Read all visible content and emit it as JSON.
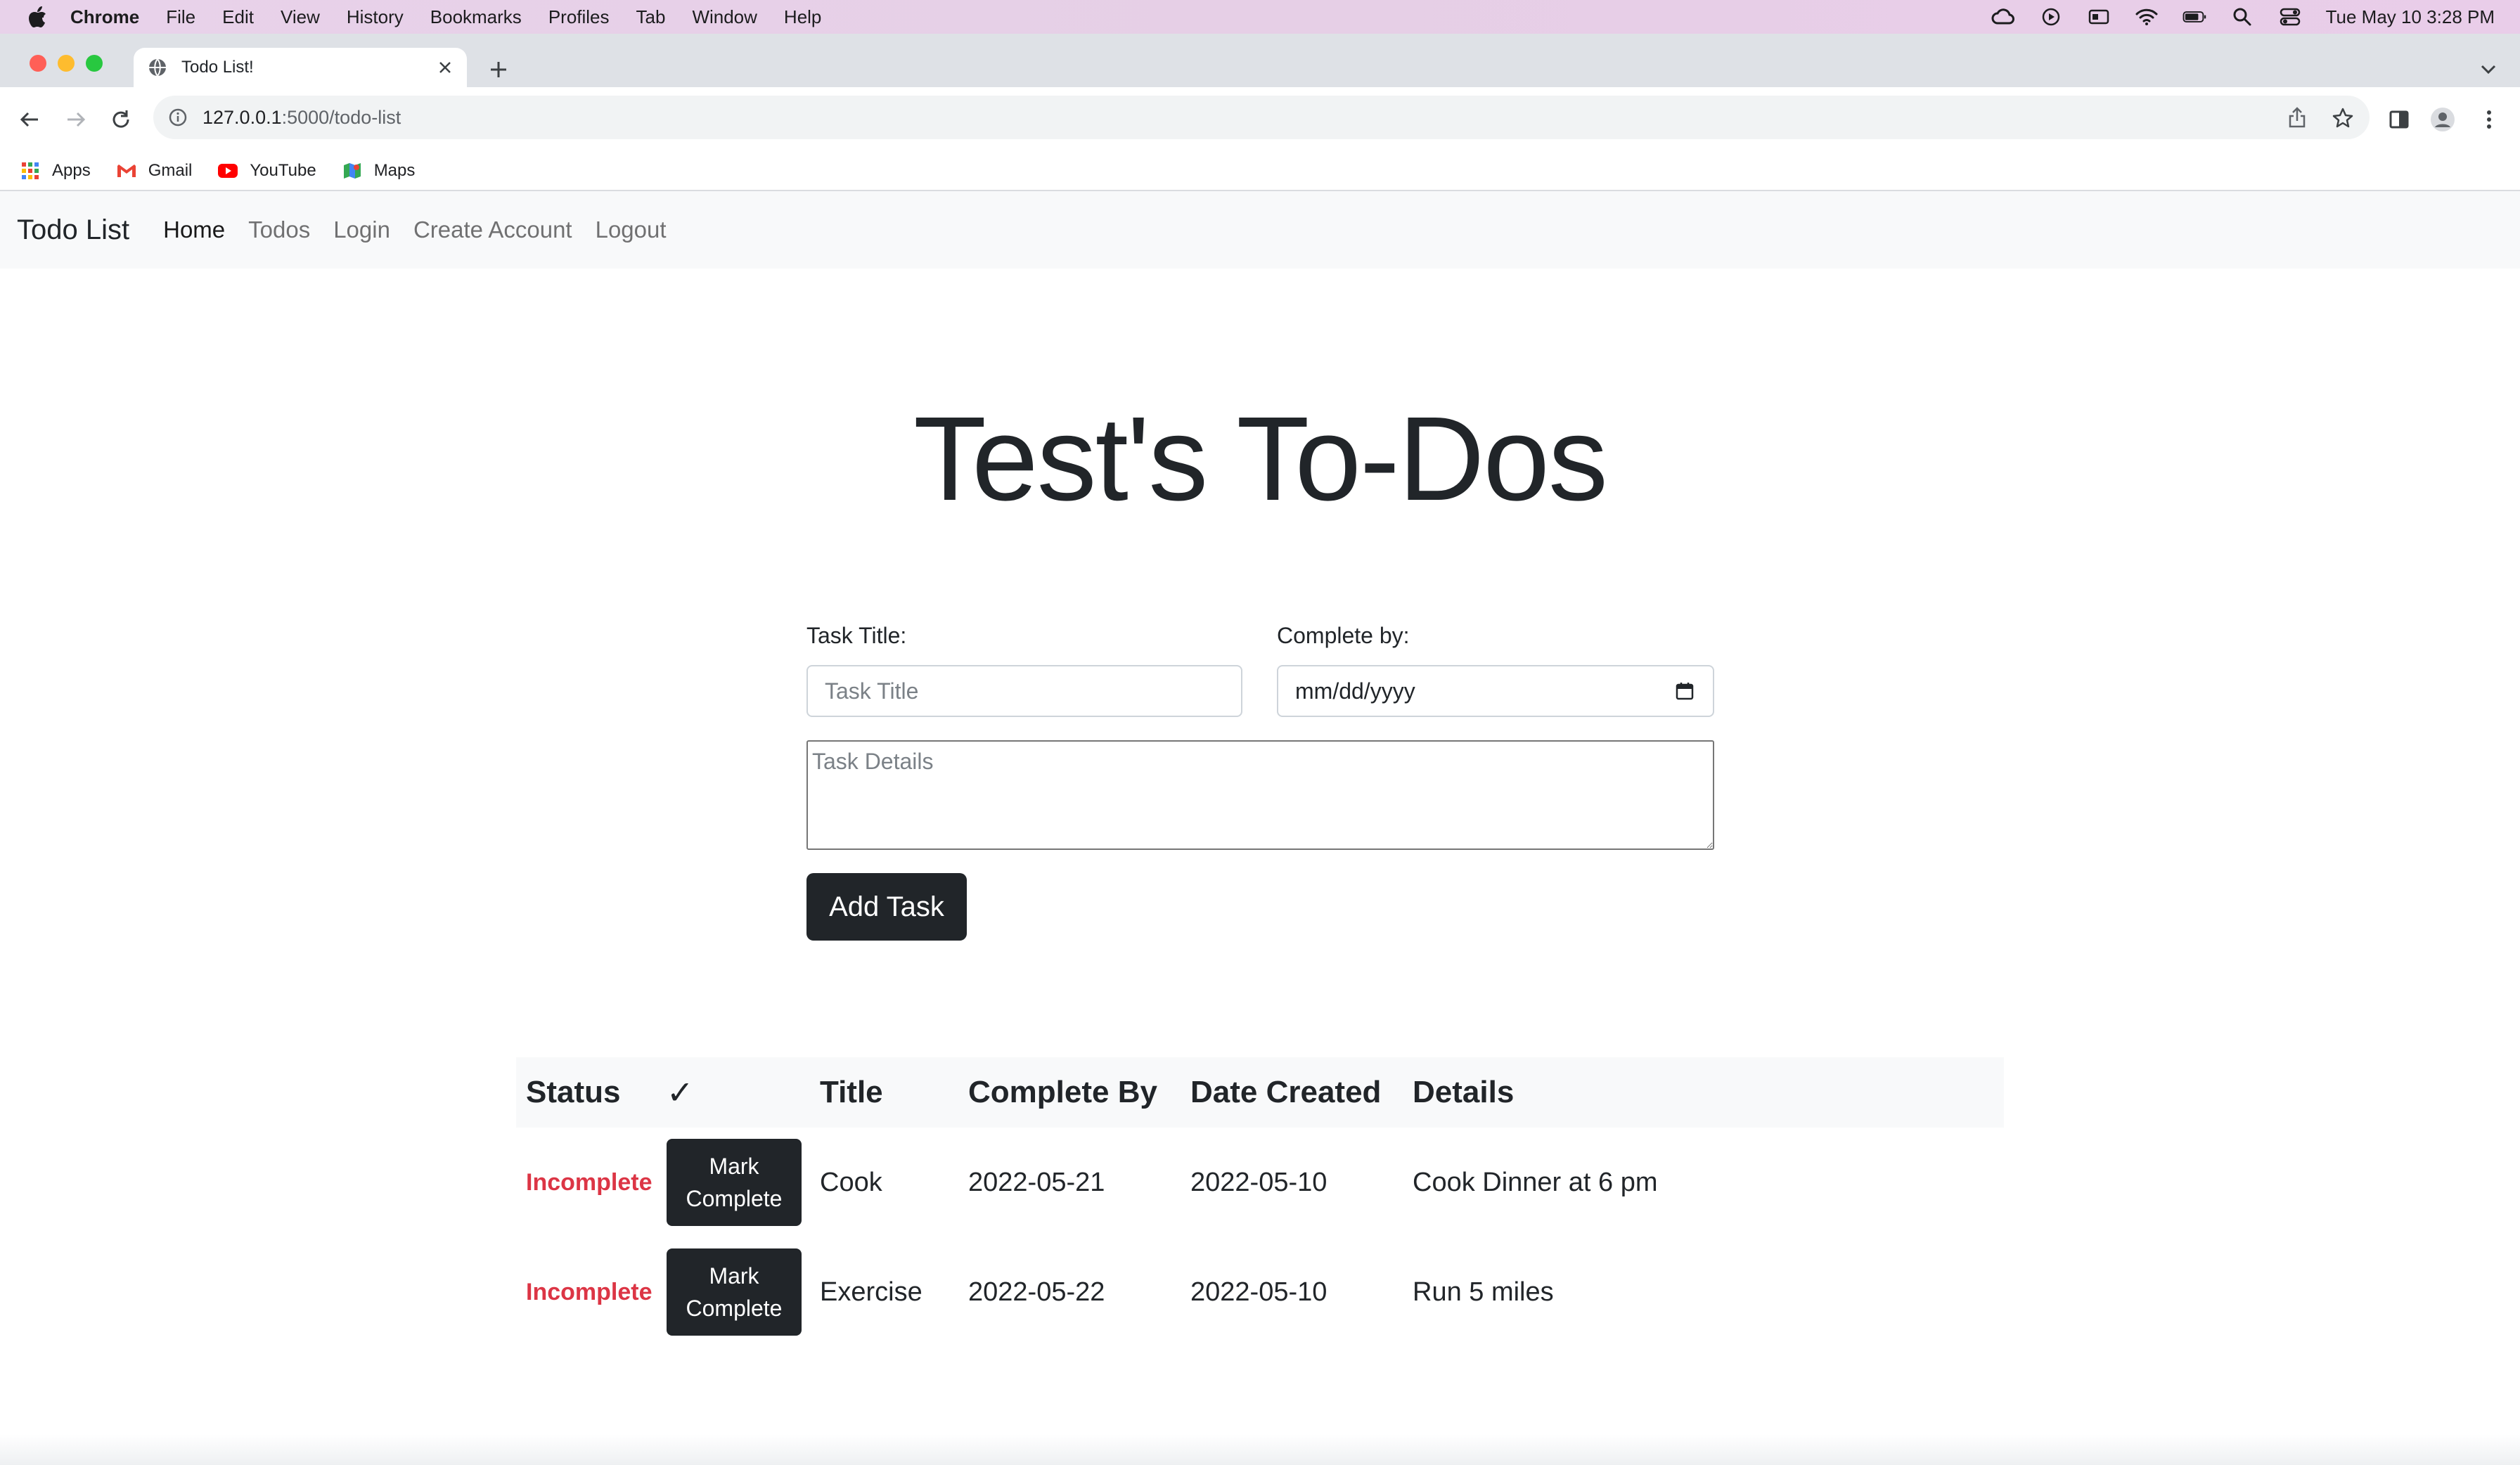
{
  "mac_menubar": {
    "app": "Chrome",
    "menus": [
      "File",
      "Edit",
      "View",
      "History",
      "Bookmarks",
      "Profiles",
      "Tab",
      "Window",
      "Help"
    ],
    "clock": "Tue May 10  3:28 PM"
  },
  "browser": {
    "tab_title": "Todo List!",
    "url_host": "127.0.0.1",
    "url_path": ":5000/todo-list",
    "bookmarks": [
      "Apps",
      "Gmail",
      "YouTube",
      "Maps"
    ]
  },
  "navbar": {
    "brand": "Todo List",
    "links": [
      "Home",
      "Todos",
      "Login",
      "Create Account",
      "Logout"
    ],
    "active": "Home"
  },
  "page": {
    "heading": "Test's To-Dos",
    "form": {
      "title_label": "Task Title:",
      "title_placeholder": "Task Title",
      "date_label": "Complete by:",
      "date_placeholder": "mm/dd/yyyy",
      "details_placeholder": "Task Details",
      "submit_label": "Add Task"
    },
    "table": {
      "headers": [
        "Status",
        "✓",
        "Title",
        "Complete By",
        "Date Created",
        "Details"
      ],
      "rows": [
        {
          "status": "Incomplete",
          "action": "Mark Complete",
          "title": "Cook",
          "complete_by": "2022-05-21",
          "date_created": "2022-05-10",
          "details": "Cook Dinner at 6 pm"
        },
        {
          "status": "Incomplete",
          "action": "Mark Complete",
          "title": "Exercise",
          "complete_by": "2022-05-22",
          "date_created": "2022-05-10",
          "details": "Run 5 miles"
        }
      ]
    }
  },
  "colors": {
    "incomplete": "#dc3545",
    "button_dark": "#212529",
    "navbar_bg": "#f8f9fa"
  }
}
